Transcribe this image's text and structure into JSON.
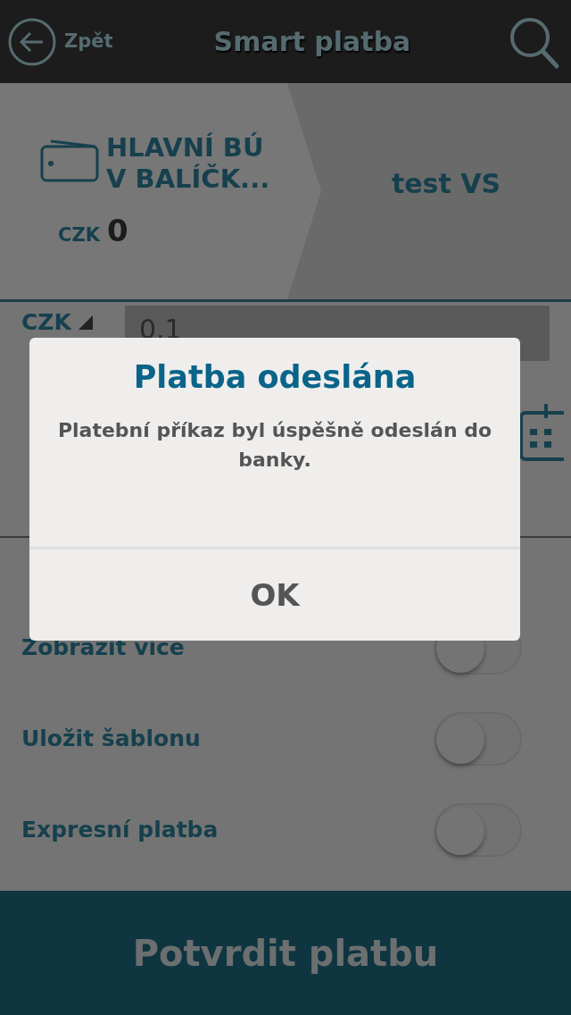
{
  "header": {
    "back_label": "Zpět",
    "title": "Smart platba"
  },
  "breadcrumb": {
    "account_name": "HLAVNÍ BÚ\nV BALÍČK...",
    "currency": "CZK",
    "balance": "0",
    "recipient": "test VS"
  },
  "amount": {
    "currency": "CZK",
    "value": "0.1"
  },
  "toggles": [
    {
      "label": "Zobrazit více",
      "on": false
    },
    {
      "label": "Uložit šablonu",
      "on": false
    },
    {
      "label": "Expresní platba",
      "on": false
    }
  ],
  "confirm_button": "Potvrdit platbu",
  "dialog": {
    "title": "Platba odeslána",
    "message": "Platební příkaz byl úspěšně odeslán do banky.",
    "button": "OK"
  }
}
